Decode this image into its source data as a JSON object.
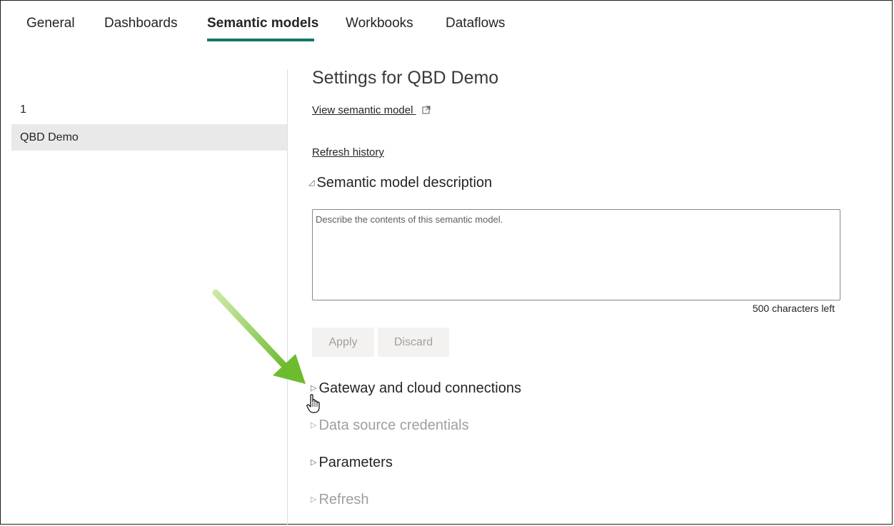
{
  "tabs": [
    {
      "label": "General",
      "active": false
    },
    {
      "label": "Dashboards",
      "active": false
    },
    {
      "label": "Semantic models",
      "active": true
    },
    {
      "label": "Workbooks",
      "active": false
    },
    {
      "label": "Dataflows",
      "active": false
    }
  ],
  "colors": {
    "accent": "#117865",
    "arrow": "#7ac143",
    "selected_bg": "#e9e9e9"
  },
  "sidebar": {
    "items": [
      {
        "label": "1",
        "selected": false
      },
      {
        "label": "QBD Demo",
        "selected": true
      }
    ]
  },
  "main": {
    "title": "Settings for QBD Demo",
    "view_link": "View semantic model",
    "view_link_icon": "external-link-icon",
    "refresh_history": "Refresh history",
    "description_section": {
      "label": "Semantic model description",
      "expanded": true,
      "placeholder": "Describe the contents of this semantic model.",
      "value": "",
      "chars_left": "500 characters left",
      "apply_label": "Apply",
      "discard_label": "Discard"
    },
    "sections": [
      {
        "label": "Gateway and cloud connections",
        "enabled": true
      },
      {
        "label": "Data source credentials",
        "enabled": false
      },
      {
        "label": "Parameters",
        "enabled": true
      },
      {
        "label": "Refresh",
        "enabled": false
      }
    ]
  },
  "annotation": {
    "icon": "green-arrow-icon"
  },
  "cursor": {
    "icon": "hand-pointer-icon"
  }
}
